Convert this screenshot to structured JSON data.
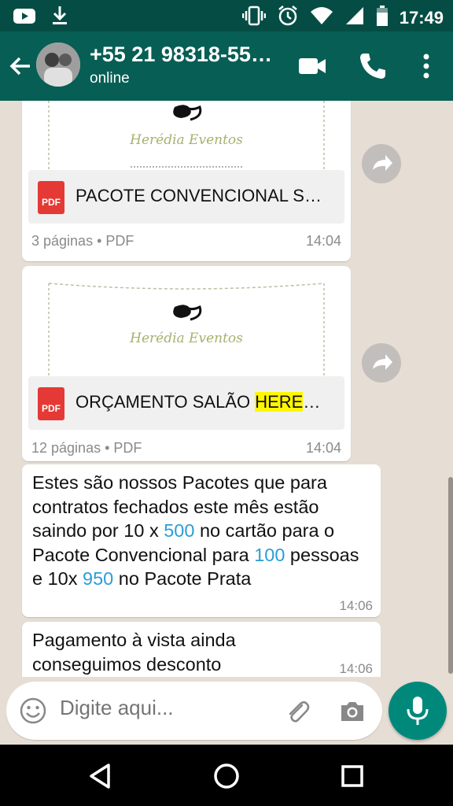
{
  "status_bar": {
    "time": "17:49",
    "left_icons": [
      "youtube-icon",
      "download-icon"
    ],
    "right_icons": [
      "vibrate-icon",
      "alarm-icon",
      "wifi-icon",
      "signal-icon",
      "battery-icon"
    ]
  },
  "header": {
    "contact_name": "+55 21 98318-55…",
    "status": "online",
    "actions": [
      "video-call-icon",
      "phone-icon",
      "more-vert-icon"
    ]
  },
  "messages": [
    {
      "type": "document",
      "preview_logo": "Herédia Eventos",
      "file_name": "PACOTE CONVENCIONAL S…",
      "meta": "3 páginas • PDF",
      "time": "14:04"
    },
    {
      "type": "document",
      "preview_logo": "Herédia Eventos",
      "file_name_prefix": "ORÇAMENTO SALÃO ",
      "file_name_highlight": "HERE",
      "file_name_suffix": "…",
      "meta": "12 páginas • PDF",
      "time": "14:04"
    },
    {
      "type": "text",
      "parts": [
        "Estes são nossos Pacotes que para contratos fechados este mês estão saindo por 10 x ",
        "500",
        " no cartão para o Pacote Convencional para ",
        "100",
        " pessoas e 10x ",
        "950",
        " no Pacote Prata"
      ],
      "time": "14:06"
    },
    {
      "type": "text",
      "text": "Pagamento à vista ainda conseguimos desconto",
      "time": "14:06"
    }
  ],
  "composer": {
    "placeholder": "Digite aqui...",
    "icons": [
      "emoji-icon",
      "attach-icon",
      "camera-icon",
      "mic-icon"
    ]
  },
  "colors": {
    "header": "#075e54",
    "status_bar": "#054d44",
    "accent": "#00897b",
    "link_number": "#2a9ed8",
    "highlight": "#fff700"
  }
}
